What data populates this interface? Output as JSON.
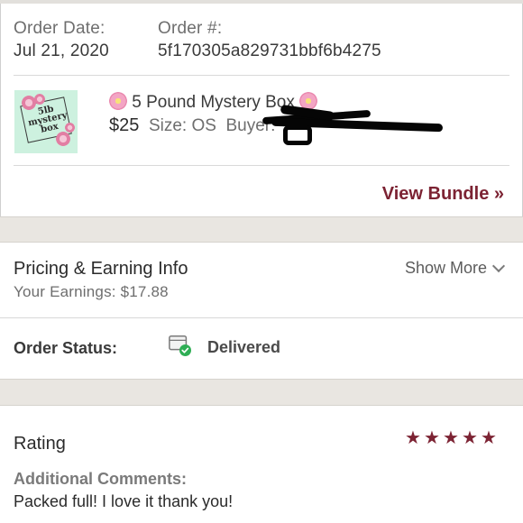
{
  "order": {
    "date_label": "Order Date:",
    "date_value": "Jul 21, 2020",
    "number_label": "Order #:",
    "number_value": "5f170305a829731bbf6b4275"
  },
  "item": {
    "thumbnail_text": "5lb mystery box",
    "title": "5 Pound Mystery Box",
    "price": "$25",
    "size": "Size: OS",
    "buyer_label": "Buyer:"
  },
  "view_bundle": "View Bundle »",
  "pricing": {
    "title": "Pricing & Earning Info",
    "earnings": "Your Earnings: $17.88",
    "show_more": "Show More"
  },
  "status": {
    "label": "Order Status:",
    "value": "Delivered"
  },
  "rating": {
    "title": "Rating",
    "stars": 5,
    "comments_label": "Additional Comments:",
    "comments": "Packed full! I love it thank you!"
  },
  "colors": {
    "accent": "#7c2333",
    "success": "#2fae55",
    "band": "#e9e6e1"
  }
}
